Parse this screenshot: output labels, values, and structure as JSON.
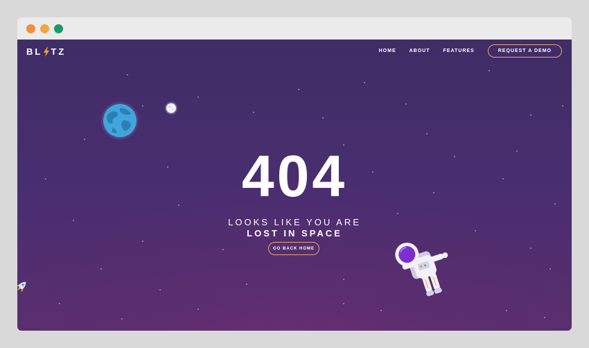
{
  "browser": {
    "dots": [
      "#ef8f3f",
      "#efa640",
      "#1a9b68"
    ]
  },
  "nav": {
    "logo_before": "BL",
    "logo_after": "TZ",
    "links": [
      "HOME",
      "ABOUT",
      "FEATURES"
    ],
    "cta": "REQUEST A DEMO"
  },
  "hero": {
    "code": "404",
    "line1": "LOOKS LIKE YOU ARE",
    "line2": "LOST IN SPACE",
    "button": "GO BACK HOME"
  },
  "colors": {
    "accent": "#f0a070",
    "background": "#45306b"
  },
  "icons": [
    "bolt-icon",
    "earth-icon",
    "moon-icon",
    "rocket-icon",
    "astronaut-icon"
  ]
}
